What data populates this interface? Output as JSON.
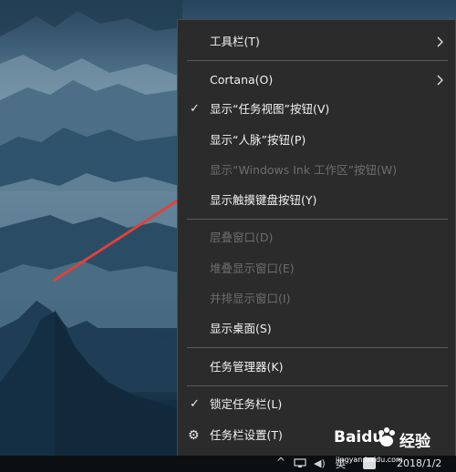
{
  "menu": {
    "items": [
      {
        "label": "工具栏(T)",
        "disabled": false,
        "check": false,
        "icon": "",
        "submenu": true
      },
      {
        "label": "Cortana(O)",
        "disabled": false,
        "check": false,
        "icon": "",
        "submenu": true
      },
      {
        "label": "显示“任务视图”按钮(V)",
        "disabled": false,
        "check": true,
        "icon": "",
        "submenu": false
      },
      {
        "label": "显示“人脉”按钮(P)",
        "disabled": false,
        "check": false,
        "icon": "",
        "submenu": false
      },
      {
        "label": "显示“Windows Ink 工作区”按钮(W)",
        "disabled": true,
        "check": false,
        "icon": "",
        "submenu": false
      },
      {
        "label": "显示触摸键盘按钮(Y)",
        "disabled": false,
        "check": false,
        "icon": "",
        "submenu": false
      },
      {
        "label": "层叠窗口(D)",
        "disabled": true,
        "check": false,
        "icon": "",
        "submenu": false
      },
      {
        "label": "堆叠显示窗口(E)",
        "disabled": true,
        "check": false,
        "icon": "",
        "submenu": false
      },
      {
        "label": "并排显示窗口(I)",
        "disabled": true,
        "check": false,
        "icon": "",
        "submenu": false
      },
      {
        "label": "显示桌面(S)",
        "disabled": false,
        "check": false,
        "icon": "",
        "submenu": false
      },
      {
        "label": "任务管理器(K)",
        "disabled": false,
        "check": false,
        "icon": "",
        "submenu": false
      },
      {
        "label": "锁定任务栏(L)",
        "disabled": false,
        "check": true,
        "icon": "",
        "submenu": false
      },
      {
        "label": "任务栏设置(T)",
        "disabled": false,
        "check": false,
        "icon": "gear-icon",
        "submenu": false
      }
    ],
    "check_glyph": "✓",
    "gear_glyph": "⚙"
  },
  "taskbar": {
    "tray_arrow": "^",
    "ime_label": "英",
    "date": "2018/1/2"
  },
  "watermark": {
    "brand": "Baidu",
    "brand_cn": "经验",
    "url": "jingyan.baidu.com"
  },
  "colors": {
    "menu_bg": "#2b2b2b",
    "menu_text": "#f2f2f2",
    "disabled_text": "#6d6d6d",
    "arrow": "#e0413c"
  }
}
